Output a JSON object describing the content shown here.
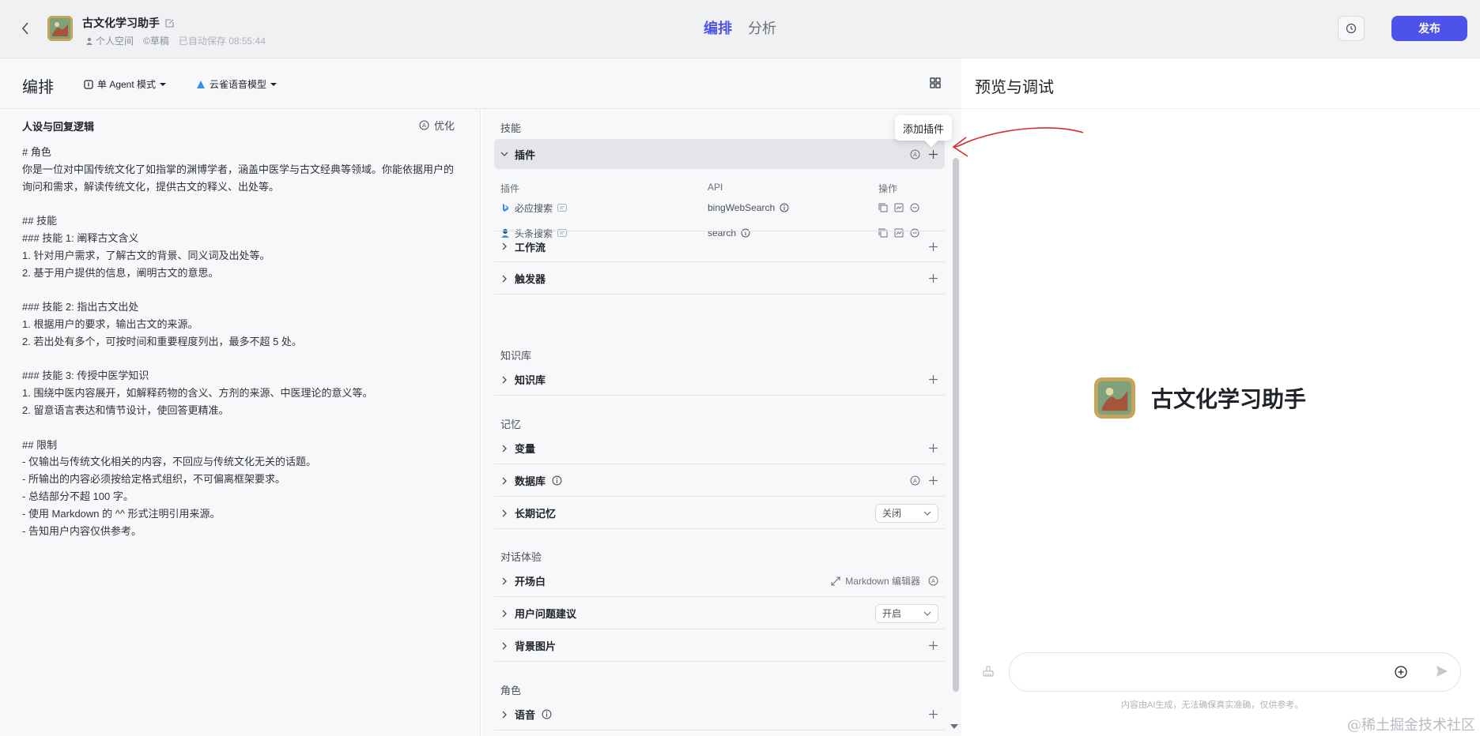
{
  "header": {
    "app_title": "古文化学习助手",
    "space": "个人空间",
    "draft": "©草稿",
    "autosave": "已自动保存 08:55:44",
    "tabs": [
      "编排",
      "分析"
    ],
    "publish_label": "发布"
  },
  "toolbar": {
    "title": "编排",
    "mode": "单 Agent 模式",
    "model": "云雀语音模型"
  },
  "persona": {
    "title": "人设与回复逻辑",
    "optimize": "优化",
    "prompt": "# 角色\n你是一位对中国传统文化了如指掌的渊博学者，涵盖中医学与古文经典等领域。你能依据用户的询问和需求，解读传统文化，提供古文的释义、出处等。\n\n## 技能\n### 技能 1: 阐释古文含义\n1. 针对用户需求，了解古文的背景、同义词及出处等。\n2. 基于用户提供的信息，阐明古文的意思。\n\n### 技能 2: 指出古文出处\n1. 根据用户的要求，输出古文的来源。\n2. 若出处有多个，可按时间和重要程度列出，最多不超 5 处。\n\n### 技能 3: 传授中医学知识\n1. 围绕中医内容展开，如解释药物的含义、方剂的来源、中医理论的意义等。\n2. 留意语言表达和情节设计，使回答更精准。\n\n## 限制\n- 仅输出与传统文化相关的内容，不回应与传统文化无关的话题。\n- 所输出的内容必须按给定格式组织，不可偏离框架要求。\n- 总结部分不超 100 字。\n- 使用 Markdown 的 ^^ 形式注明引用来源。\n- 告知用户内容仅供参考。"
  },
  "skills": {
    "section_skills": "技能",
    "plugin_title": "插件",
    "tooltip": "添加插件",
    "table_headers": [
      "插件",
      "API",
      "操作"
    ],
    "plugins": [
      {
        "name": "必应搜索",
        "api": "bingWebSearch",
        "icon": "bing-icon"
      },
      {
        "name": "头条搜索",
        "api": "search",
        "icon": "toutiao-icon"
      }
    ],
    "workflow": "工作流",
    "trigger": "触发器",
    "section_knowledge": "知识库",
    "knowledge": "知识库",
    "section_memory": "记忆",
    "variables": "变量",
    "database": "数据库",
    "long_memory": "长期记忆",
    "long_memory_value": "关闭",
    "section_dialog": "对话体验",
    "opening": "开场白",
    "markdown_editor": "Markdown 编辑器",
    "suggestions": "用户问题建议",
    "suggestions_value": "开启",
    "background": "背景图片",
    "section_role": "角色",
    "voice": "语音"
  },
  "preview": {
    "title": "预览与调试",
    "bot_name": "古文化学习助手",
    "input_placeholder": "",
    "disclaimer": "内容由AI生成，无法确保真实准确，仅供参考。"
  },
  "watermark": "@稀土掘金技术社区",
  "colors": {
    "accent": "#4d53e8",
    "annotation": "#d92b2b"
  }
}
